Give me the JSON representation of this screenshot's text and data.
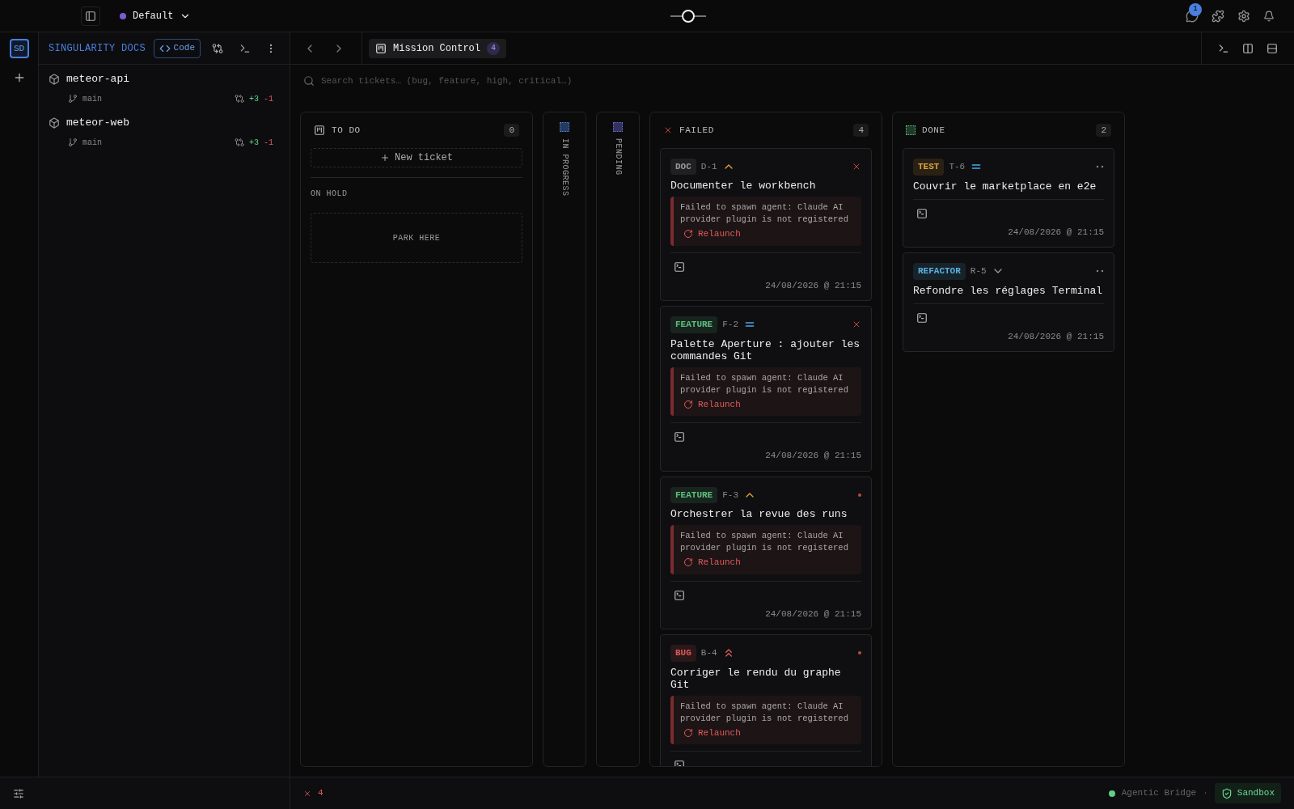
{
  "topbar": {
    "workspace": "Default",
    "notification_count": "1"
  },
  "rail": {
    "avatar": "SD"
  },
  "sidebar": {
    "title": "SINGULARITY DOCS",
    "code_button": "Code",
    "repos": [
      {
        "name": "meteor-api",
        "branch": "main",
        "added": "+3",
        "removed": "-1"
      },
      {
        "name": "meteor-web",
        "branch": "main",
        "added": "+3",
        "removed": "-1"
      }
    ]
  },
  "tabs": [
    {
      "label": "Mission Control",
      "count": "4",
      "selected": true
    }
  ],
  "search": {
    "placeholder": "Search tickets… (bug, feature, high, critical…)"
  },
  "columns": [
    {
      "kind": "todo",
      "title": "TO DO",
      "count": "0",
      "new_ticket": "New ticket",
      "on_hold": "ON HOLD",
      "park": "PARK HERE"
    },
    {
      "kind": "collapsed",
      "title": "IN PROGRESS",
      "color": "#4a7fd4"
    },
    {
      "kind": "collapsed",
      "title": "PENDING",
      "color": "#6a6ad8"
    },
    {
      "kind": "failed",
      "title": "FAILED",
      "count": "4",
      "cards": [
        {
          "tag": "DOC",
          "color": "#9a9a9a",
          "id": "D-1",
          "priority": {
            "kind": "high"
          },
          "marker": {
            "kind": "close"
          },
          "title": "Documenter le workbench",
          "error": "Failed to spawn agent: Claude AI provider plugin is not registered",
          "action": "Relaunch",
          "time": "24/08/2026 @ 21:15"
        },
        {
          "tag": "FEATURE",
          "color": "#5fbf7f",
          "id": "F-2",
          "priority": {
            "kind": "medium"
          },
          "marker": {
            "kind": "close"
          },
          "title": "Palette Aperture : ajouter les commandes Git",
          "error": "Failed to spawn agent: Claude AI provider plugin is not registered",
          "action": "Relaunch",
          "time": "24/08/2026 @ 21:15"
        },
        {
          "tag": "FEATURE",
          "color": "#5fbf7f",
          "id": "F-3",
          "priority": {
            "kind": "high"
          },
          "marker": {
            "kind": "dot"
          },
          "title": "Orchestrer la revue des runs",
          "error": "Failed to spawn agent: Claude AI provider plugin is not registered",
          "action": "Relaunch",
          "time": "24/08/2026 @ 21:15"
        },
        {
          "tag": "BUG",
          "color": "#e05a5a",
          "id": "B-4",
          "priority": {
            "kind": "critical"
          },
          "marker": {
            "kind": "dot"
          },
          "title": "Corriger le rendu du graphe Git",
          "error": "Failed to spawn agent: Claude AI provider plugin is not registered",
          "action": "Relaunch"
        }
      ]
    },
    {
      "kind": "done",
      "title": "DONE",
      "count": "2",
      "cards": [
        {
          "tag": "TEST",
          "color": "#e0a040",
          "id": "T-6",
          "priority": {
            "kind": "medium"
          },
          "marker": {
            "kind": "more"
          },
          "title": "Couvrir le marketplace en e2e",
          "time": "24/08/2026 @ 21:15"
        },
        {
          "tag": "REFACTOR",
          "color": "#5ab0e0",
          "id": "R-5",
          "priority": {
            "kind": "low"
          },
          "marker": {
            "kind": "more"
          },
          "title": "Refondre les réglages Terminal",
          "time": "24/08/2026 @ 21:15"
        }
      ]
    }
  ],
  "status_bar": {
    "errors": "4",
    "bridge": "Agentic Bridge",
    "bridge_online": true,
    "separator": "·",
    "sandbox": "Sandbox"
  }
}
